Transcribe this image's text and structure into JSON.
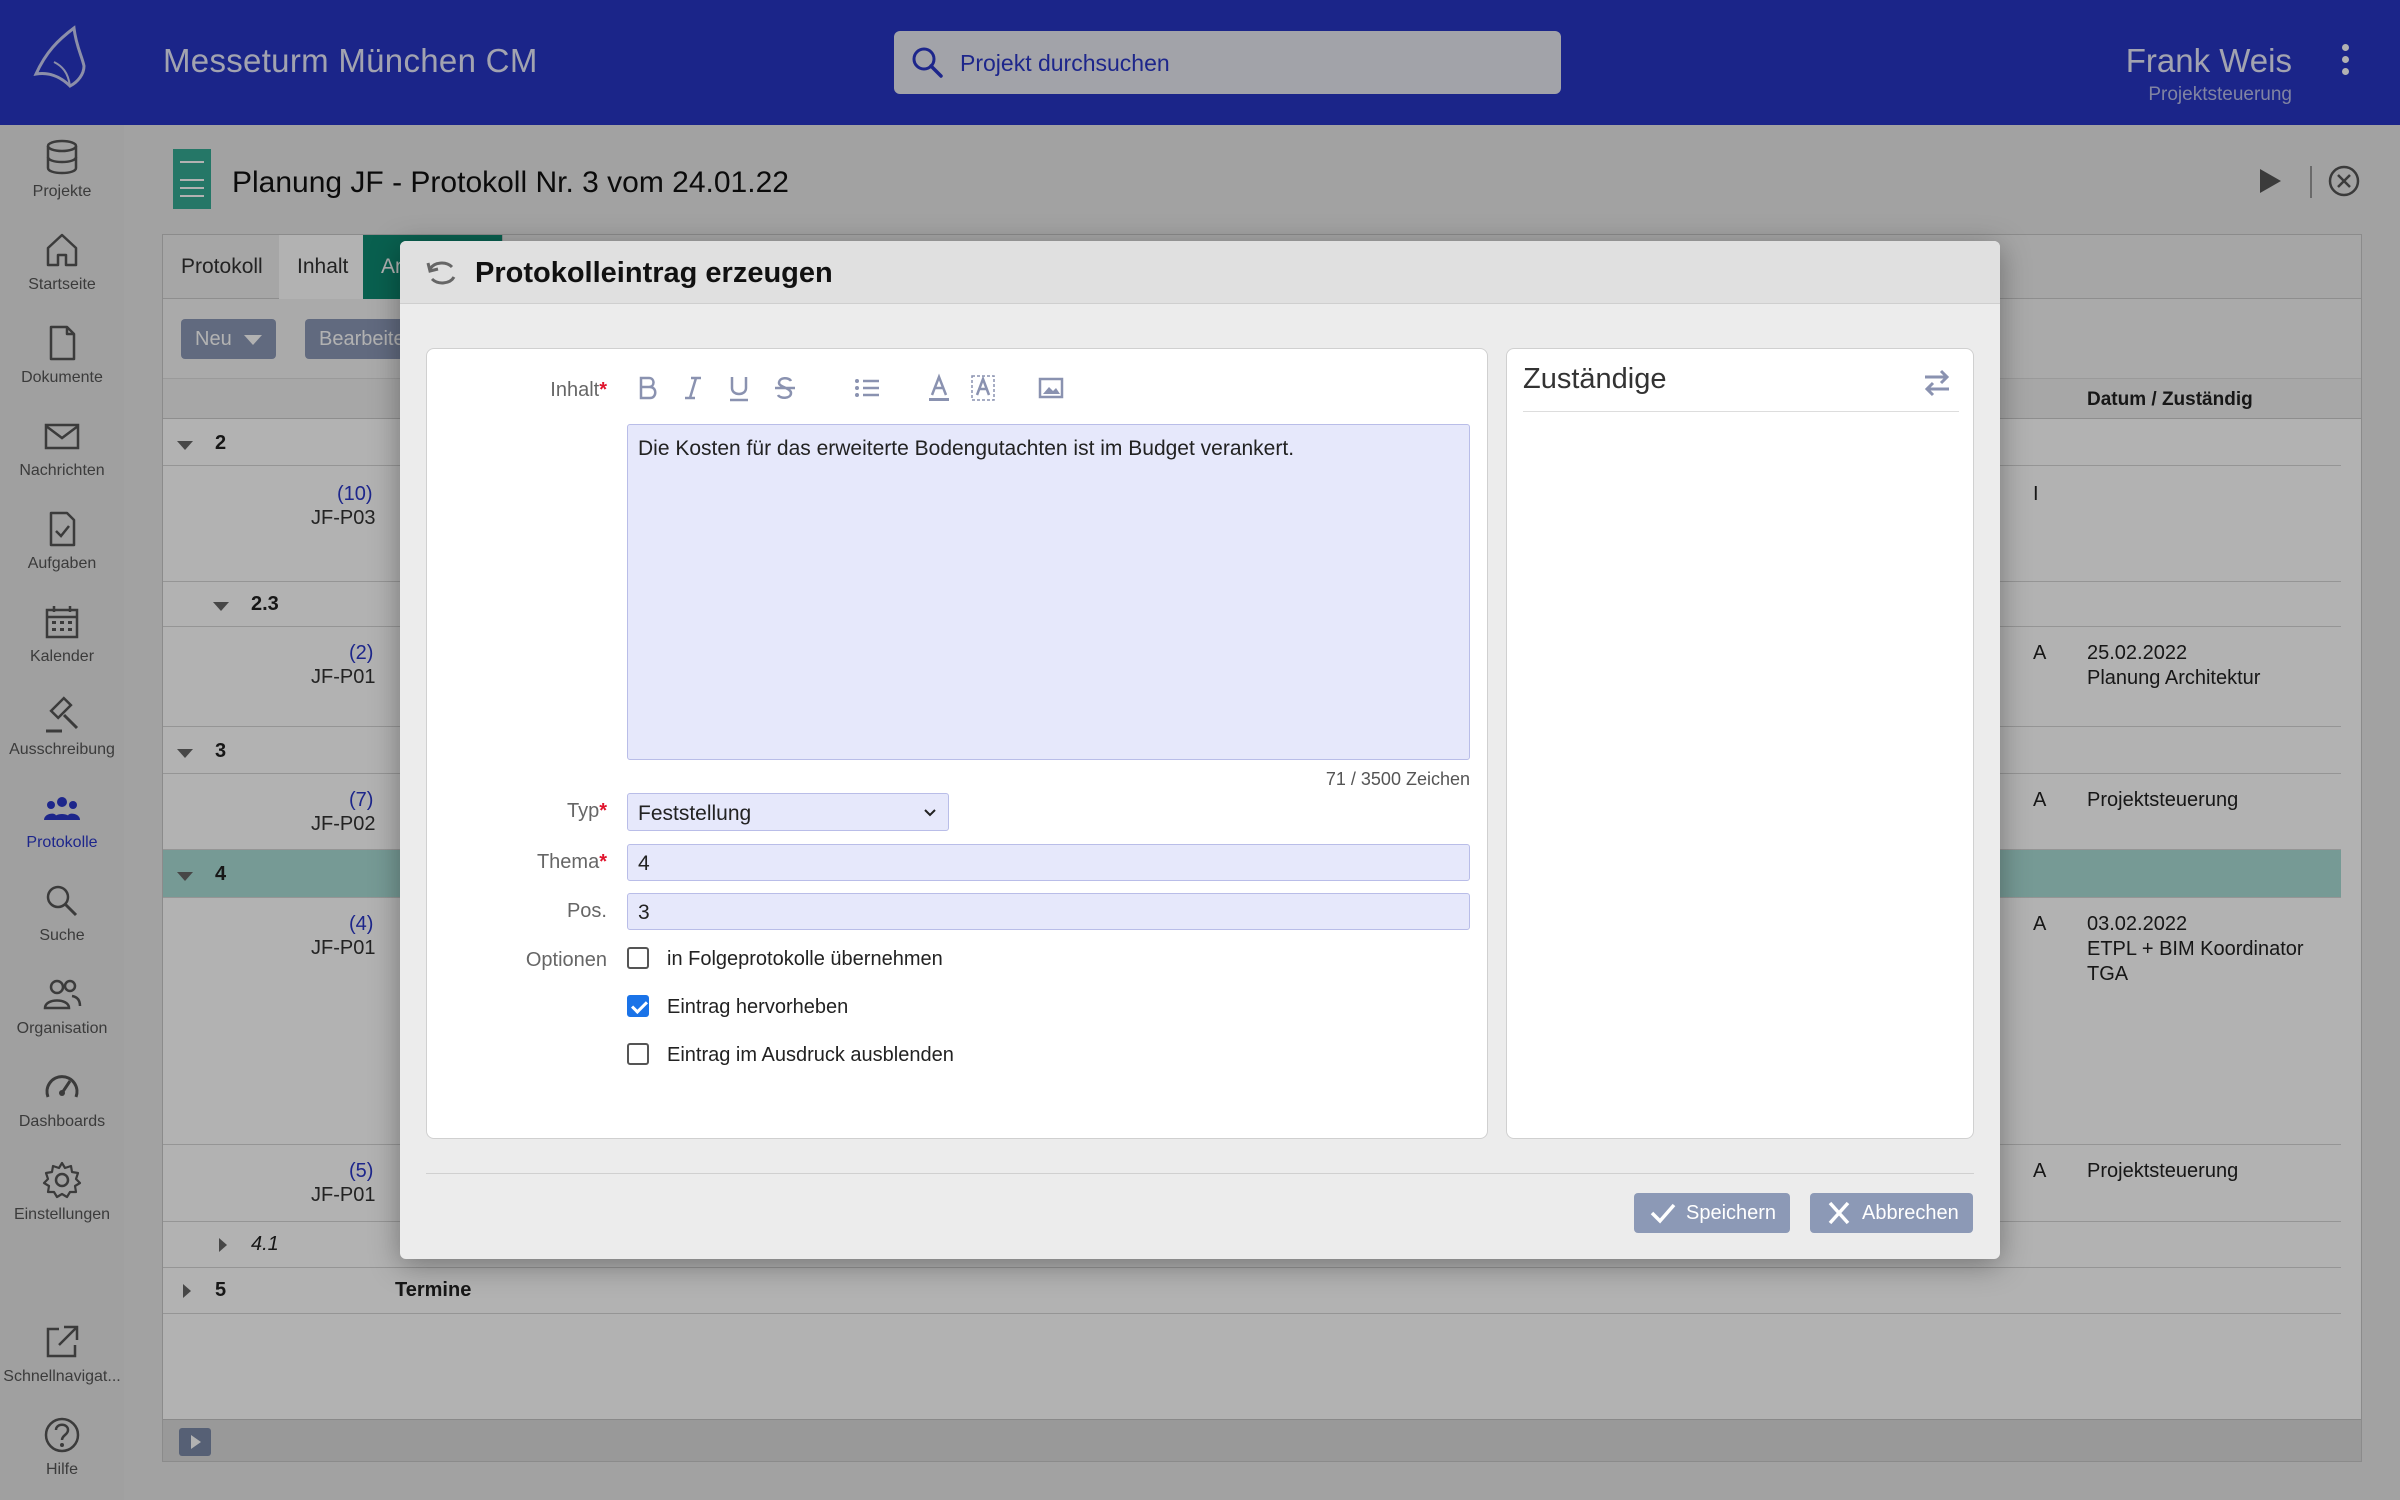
{
  "topbar": {
    "app_title": "Messeturm München CM",
    "search_placeholder": "Projekt durchsuchen",
    "user_name": "Frank Weis",
    "user_role": "Projektsteuerung"
  },
  "sidebar": {
    "items": [
      {
        "label": "Projekte",
        "icon": "database-icon"
      },
      {
        "label": "Startseite",
        "icon": "home-icon"
      },
      {
        "label": "Dokumente",
        "icon": "document-icon"
      },
      {
        "label": "Nachrichten",
        "icon": "mail-icon"
      },
      {
        "label": "Aufgaben",
        "icon": "task-icon"
      },
      {
        "label": "Kalender",
        "icon": "calendar-icon"
      },
      {
        "label": "Ausschreibung",
        "icon": "gavel-icon"
      },
      {
        "label": "Protokolle",
        "icon": "group-icon",
        "active": true
      },
      {
        "label": "Suche",
        "icon": "search-icon"
      },
      {
        "label": "Organisation",
        "icon": "people-icon"
      },
      {
        "label": "Dashboards",
        "icon": "gauge-icon"
      },
      {
        "label": "Einstellungen",
        "icon": "gear-icon"
      }
    ],
    "bottom_items": [
      {
        "label": "Schnellnavigat...",
        "icon": "external-link-icon"
      },
      {
        "label": "Hilfe",
        "icon": "help-icon"
      }
    ]
  },
  "page": {
    "title": "Planung JF - Protokoll Nr. 3 vom 24.01.22",
    "tabs": [
      "Protokoll",
      "Inhalt",
      "An"
    ],
    "toolbar": {
      "new_label": "Neu",
      "edit_label": "Bearbeite"
    },
    "table_header": {
      "date_col": "Datum / Zuständig"
    },
    "rows": [
      {
        "num": "2",
        "status": "",
        "date": ""
      },
      {
        "ref": "(10)",
        "code": "JF-P03",
        "status": "I",
        "date": ""
      },
      {
        "num": "2.3"
      },
      {
        "ref": "(2)",
        "code": "JF-P01",
        "status": "A",
        "date": "25.02.2022\nPlanung Architektur"
      },
      {
        "num": "3"
      },
      {
        "ref": "(7)",
        "code": "JF-P02",
        "status": "A",
        "date": "Projektsteuerung"
      },
      {
        "num": "4"
      },
      {
        "ref": "(4)",
        "code": "JF-P01",
        "status": "A",
        "date": "03.02.2022\nETPL + BIM Koordinator\nTGA"
      },
      {
        "ref": "(5)",
        "code": "JF-P01",
        "status": "A",
        "date": "Projektsteuerung"
      },
      {
        "num": "4.1"
      },
      {
        "num": "5",
        "title": "Termine"
      }
    ]
  },
  "modal": {
    "title": "Protokolleintrag erzeugen",
    "content_label": "Inhalt",
    "content_text": "Die Kosten für das erweiterte Bodengutachten ist im Budget verankert.",
    "char_count": "71  /  3500  Zeichen",
    "type_label": "Typ",
    "type_value": "Feststellung",
    "topic_label": "Thema",
    "topic_value": "4",
    "pos_label": "Pos.",
    "pos_value": "3",
    "options_label": "Optionen",
    "options": [
      {
        "label": "in Folgeprotokolle übernehmen",
        "checked": false
      },
      {
        "label": "Eintrag hervorheben",
        "checked": true
      },
      {
        "label": "Eintrag im Ausdruck ausblenden",
        "checked": false
      }
    ],
    "responsible_title": "Zuständige",
    "save_label": "Speichern",
    "cancel_label": "Abbrechen",
    "required_mark": "*"
  },
  "colors": {
    "topbar": "#2735c4",
    "accent_blue": "#2a37c7",
    "tab_green": "#0e8a72",
    "row_highlight": "#a9ddd6",
    "button_gray_blue": "#8c99b6",
    "input_bg": "#e6e8fb",
    "required": "#e0142d",
    "checkbox_on": "#1a73e8"
  }
}
